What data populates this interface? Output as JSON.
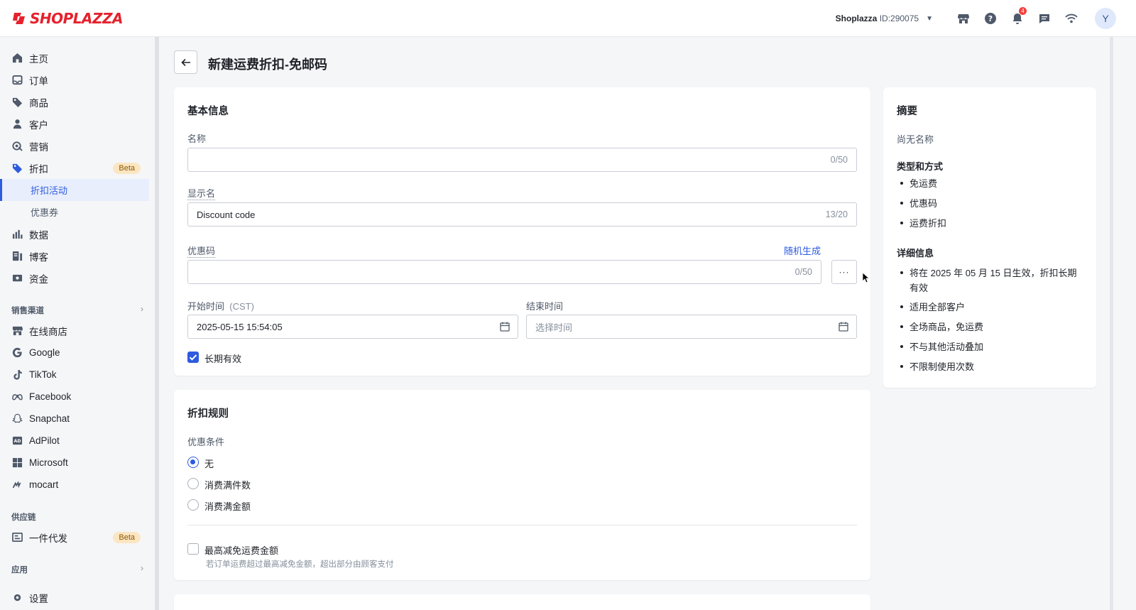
{
  "brand": {
    "logo_text": "SHOPLAZZA",
    "brand_color": "#e5212d"
  },
  "topbar": {
    "store_name": "Shoplazza",
    "store_id": "ID:290075",
    "notification_count": "4",
    "avatar_letter": "Y",
    "icons": [
      "store-icon",
      "help-icon",
      "bell-icon",
      "chat-icon",
      "wifi-icon"
    ]
  },
  "sidebar": {
    "items": [
      {
        "label": "主页",
        "icon": "home-icon"
      },
      {
        "label": "订单",
        "icon": "inbox-icon"
      },
      {
        "label": "商品",
        "icon": "tag-icon"
      },
      {
        "label": "客户",
        "icon": "person-icon"
      },
      {
        "label": "营销",
        "icon": "marketing-icon"
      },
      {
        "label": "折扣",
        "icon": "discount-icon",
        "badge": "Beta"
      }
    ],
    "discount_sub": [
      {
        "label": "折扣活动",
        "active": true
      },
      {
        "label": "优惠券",
        "active": false
      }
    ],
    "items2": [
      {
        "label": "数据",
        "icon": "chart-icon"
      },
      {
        "label": "博客",
        "icon": "blog-icon"
      },
      {
        "label": "资金",
        "icon": "funds-icon"
      }
    ],
    "sales_channel_title": "销售渠道",
    "channels": [
      {
        "label": "在线商店",
        "icon": "store-icon"
      },
      {
        "label": "Google",
        "icon": "google-icon"
      },
      {
        "label": "TikTok",
        "icon": "tiktok-icon"
      },
      {
        "label": "Facebook",
        "icon": "meta-icon"
      },
      {
        "label": "Snapchat",
        "icon": "snapchat-icon"
      },
      {
        "label": "AdPilot",
        "icon": "adpilot-icon"
      },
      {
        "label": "Microsoft",
        "icon": "microsoft-icon"
      },
      {
        "label": "mocart",
        "icon": "mocart-icon"
      }
    ],
    "supply_title": "供应链",
    "supply_item": {
      "label": "一件代发",
      "badge": "Beta"
    },
    "apps_title": "应用",
    "settings_label": "设置"
  },
  "page": {
    "title": "新建运费折扣-免邮码"
  },
  "basic": {
    "title": "基本信息",
    "name_label": "名称",
    "name_value": "",
    "name_count": "0/50",
    "display_label": "显示名",
    "display_value": "Discount code",
    "display_count": "13/20",
    "code_label": "优惠码",
    "random_link": "随机生成",
    "code_value": "",
    "code_count": "0/50",
    "more_label": "···",
    "start_label": "开始时间",
    "start_tz": "(CST)",
    "start_value": "2025-05-15 15:54:05",
    "end_label": "结束时间",
    "end_placeholder": "选择时间",
    "long_term_label": "长期有效",
    "long_term_checked": true
  },
  "rules": {
    "title": "折扣规则",
    "condition_label": "优惠条件",
    "options": [
      "无",
      "消费满件数",
      "消费满金额"
    ],
    "selected": "无",
    "max_label": "最高减免运费金额",
    "max_hint": "若订单运费超过最高减免金额，超出部分由顾客支付",
    "max_checked": false
  },
  "summary": {
    "title": "摘要",
    "no_name": "尚无名称",
    "type_title": "类型和方式",
    "type_items": [
      "免运费",
      "优惠码",
      "运费折扣"
    ],
    "detail_title": "详细信息",
    "detail_items": [
      "将在 2025 年 05 月 15 日生效，折扣长期有效",
      "适用全部客户",
      "全场商品，免运费",
      "不与其他活动叠加",
      "不限制使用次数"
    ]
  },
  "colors": {
    "accent": "#2e5bdf",
    "beta_bg": "#fce6c2",
    "badge": "#f53f3f"
  }
}
